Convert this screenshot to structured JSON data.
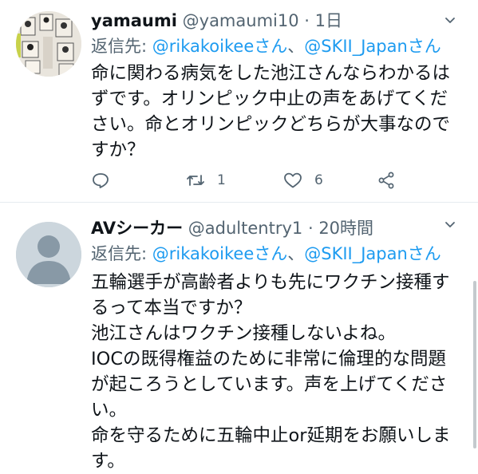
{
  "tweets": [
    {
      "name": "yamaumi",
      "handle": "@yamaumi10",
      "separator": "·",
      "time": "1日",
      "reply_prefix": "返信先: ",
      "mention1": "@rikakoikeeさん",
      "joiner": "、",
      "mention2": "@SKII_Japanさん",
      "body": "命に関わる病気をした池江さんならわかるは\nずです。オリンピック中止の声をあげてくだ\nさい。命とオリンピックどちらが大事なので\nすか？",
      "actions": {
        "reply_icon": "reply-icon",
        "retweet_icon": "retweet-icon",
        "retweet_count": "1",
        "like_icon": "heart-icon",
        "like_count": "6",
        "share_icon": "share-icon"
      }
    },
    {
      "name": "AVシーカー",
      "handle": "@adultentry1",
      "separator": "·",
      "time": "20時間",
      "reply_prefix": "返信先: ",
      "mention1": "@rikakoikeeさん",
      "joiner": "、",
      "mention2": "@SKII_Japanさん",
      "body": "五輪選手が高齢者よりも先にワクチン接種す\nるって本当ですか？\n池江さんはワクチン接種しないよね。\nIOCの既得権益のために非常に倫理的な問題\nが起ころうとしています。声を上げてくださ\nい。\n命を守るために五輪中止or延期をお願いしま\nす。"
    }
  ],
  "colors": {
    "accent": "#1d9bf0",
    "secondary": "#536471",
    "text": "#0f1419",
    "divider": "#e6ecf0"
  }
}
